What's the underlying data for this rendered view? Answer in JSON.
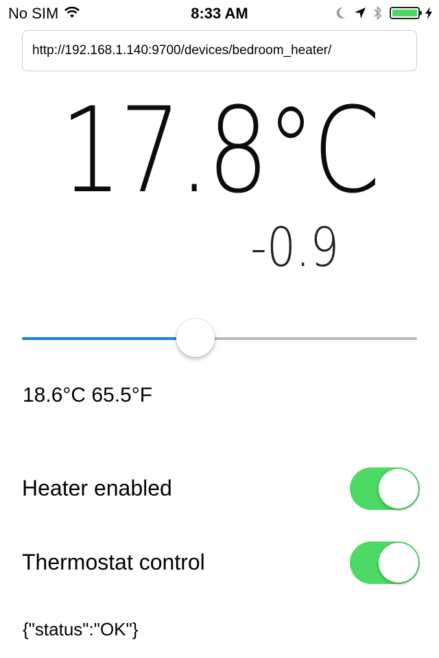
{
  "status_bar": {
    "carrier": "No SIM",
    "time": "8:33 AM",
    "icons": [
      "wifi-icon",
      "moon-icon",
      "location-arrow-icon",
      "bluetooth-icon",
      "battery-icon",
      "charging-bolt-icon"
    ],
    "battery_level": 1.0,
    "battery_color": "#4cd964"
  },
  "url_field": {
    "value": "http://192.168.1.140:9700/devices/bedroom_heater/"
  },
  "temperature": {
    "current": "17.8°C",
    "delta": "-0.9"
  },
  "slider": {
    "level": 0.44,
    "fill_color": "#1a7ef0",
    "track_color": "#b8b8b8"
  },
  "setpoint": {
    "text": "18.6°C 65.5°F"
  },
  "toggles": [
    {
      "label": "Heater enabled",
      "on": true
    },
    {
      "label": "Thermostat control",
      "on": true
    }
  ],
  "toggle_on_color": "#4cd964",
  "response": {
    "text": "{\"status\":\"OK\"}"
  }
}
